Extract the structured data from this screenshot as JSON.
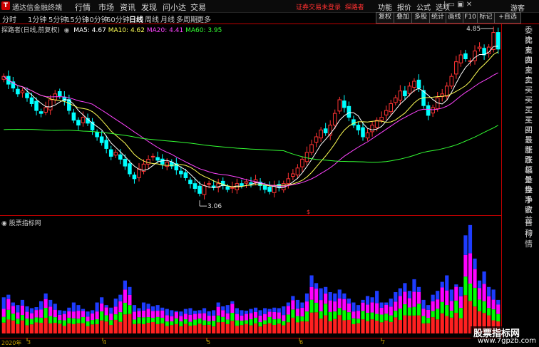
{
  "app": {
    "title": "通达信金融终端",
    "logo": "T",
    "menu": [
      "行情",
      "市场",
      "资讯",
      "发现",
      "问小达",
      "交易"
    ],
    "notice": "证券交易未登录",
    "notice_link": "探路者",
    "right_menu": [
      "功能",
      "报价",
      "公式",
      "选项"
    ],
    "window_controls": "| ▭ ▣ ✕",
    "guest": "游客"
  },
  "periods": [
    "分时",
    "1分钟",
    "5分钟",
    "15分钟",
    "30分钟",
    "60分钟",
    "日线",
    "周线",
    "月线",
    "多周期",
    "更多"
  ],
  "active_period": "日线",
  "toolbar": [
    "复权",
    "叠加",
    "多股",
    "统计",
    "画线",
    "F10",
    "标记",
    "+自选"
  ],
  "main": {
    "name": "探路者(日线,前复权)",
    "ma": [
      {
        "label": "MA5: 4.67",
        "color": "#ffffff"
      },
      {
        "label": "MA10: 4.62",
        "color": "#ffff55"
      },
      {
        "label": "MA20: 4.41",
        "color": "#ff44ff"
      },
      {
        "label": "MA60: 3.95",
        "color": "#33ff33"
      }
    ],
    "high_label": "4.85",
    "low_label": "3.06",
    "yticks": [
      "4.80",
      "4.60",
      "4.40",
      "4.20",
      "4.00",
      "3.80",
      "3.60",
      "3.40",
      "3.20"
    ],
    "yrange": [
      3.02,
      4.92
    ],
    "marker": "$",
    "colors": {
      "up": "#ff3333",
      "down": "#00ffff",
      "ma5": "#ffffff",
      "ma10": "#ffff55",
      "ma20": "#ff44ff",
      "ma60": "#33ff33",
      "axis": "#c00000"
    }
  },
  "volume": {
    "name": "股票指标网",
    "yticks": [
      "40000",
      "35000",
      "30000",
      "25000",
      "20000",
      "15000",
      "10000",
      "5000"
    ],
    "ymax": 42500,
    "colors": {
      "red": "#ff2020",
      "green": "#00ff00",
      "magenta": "#ff00ff",
      "blue": "#1e3cff"
    }
  },
  "side_panel": [
    "委比",
    "卖五",
    "卖四",
    "卖三",
    "卖二",
    "卖一",
    "买一",
    "买二",
    "买三",
    "买四",
    "买五",
    "最新",
    "涨跌",
    "涨幅",
    "总量",
    "外盘",
    "换手",
    "净资",
    "收益"
  ],
  "side_bottom": [
    "自动",
    "行情"
  ],
  "xaxis": [
    "2020年",
    "3",
    "4",
    "5",
    "6",
    "7"
  ],
  "watermark": {
    "line1": "股票指标网",
    "line2": "www.7gpzb.com"
  },
  "chart_data": {
    "type": "candlestick",
    "title": "探路者(日线,前复权)",
    "series": [
      {
        "name": "MA5",
        "values": [
          4.67
        ]
      },
      {
        "name": "MA10",
        "values": [
          4.62
        ]
      },
      {
        "name": "MA20",
        "values": [
          4.41
        ]
      },
      {
        "name": "MA60",
        "values": [
          3.95
        ]
      }
    ],
    "y_ticks": [
      4.8,
      4.6,
      4.4,
      4.2,
      4.0,
      3.8,
      3.6,
      3.4,
      3.2
    ],
    "ylim": [
      3.02,
      4.92
    ],
    "annotations": [
      {
        "label": "4.85"
      },
      {
        "label": "3.06"
      }
    ],
    "close": [
      4.4,
      4.32,
      4.28,
      4.22,
      4.25,
      4.18,
      4.12,
      4.05,
      4.02,
      4.08,
      4.16,
      4.22,
      4.2,
      4.15,
      4.05,
      3.95,
      3.9,
      3.98,
      3.92,
      3.85,
      3.78,
      3.72,
      3.66,
      3.58,
      3.62,
      3.55,
      3.48,
      3.4,
      3.35,
      3.45,
      3.5,
      3.55,
      3.58,
      3.54,
      3.5,
      3.52,
      3.48,
      3.44,
      3.4,
      3.36,
      3.3,
      3.25,
      3.2,
      3.28,
      3.3,
      3.26,
      3.3,
      3.28,
      3.24,
      3.26,
      3.3,
      3.28,
      3.32,
      3.3,
      3.34,
      3.28,
      3.24,
      3.22,
      3.28,
      3.26,
      3.3,
      3.35,
      3.4,
      3.46,
      3.55,
      3.62,
      3.7,
      3.78,
      3.85,
      3.82,
      3.9,
      4.02,
      4.16,
      4.08,
      3.98,
      3.9,
      3.85,
      3.78,
      3.82,
      3.9,
      3.95,
      3.98,
      4.05,
      4.12,
      4.18,
      4.25,
      4.2,
      4.3,
      4.35,
      4.28,
      4.1,
      4.0,
      4.08,
      4.18,
      4.22,
      4.3,
      4.4,
      4.55,
      4.62,
      4.58,
      4.56,
      4.66,
      4.7,
      4.62,
      4.7,
      4.85,
      4.68
    ],
    "volume": [
      14000,
      15000,
      12000,
      11000,
      13000,
      10500,
      9800,
      10200,
      12500,
      15500,
      13000,
      11500,
      9000,
      8800,
      10000,
      12000,
      11000,
      9500,
      8500,
      9000,
      12000,
      14000,
      11000,
      10000,
      13500,
      15000,
      20500,
      18000,
      11000,
      9800,
      12000,
      11500,
      10500,
      11000,
      10000,
      9500,
      9000,
      8700,
      8500,
      9500,
      9800,
      8800,
      9000,
      9800,
      8600,
      9000,
      12000,
      10500,
      11000,
      12500,
      9800,
      9000,
      8800,
      9500,
      10000,
      9000,
      9800,
      9500,
      10000,
      9800,
      10500,
      12000,
      14500,
      13000,
      12000,
      15500,
      22500,
      19500,
      17500,
      18000,
      16000,
      15500,
      17000,
      15500,
      13500,
      12000,
      11000,
      13000,
      14500,
      14000,
      16500,
      12000,
      12000,
      13500,
      16000,
      17500,
      19500,
      16500,
      21000,
      18000,
      13000,
      11000,
      15000,
      16500,
      20000,
      22500,
      17000,
      19000,
      18000,
      38000,
      42000,
      29000,
      20500,
      24000,
      18000,
      17000,
      13000
    ]
  }
}
